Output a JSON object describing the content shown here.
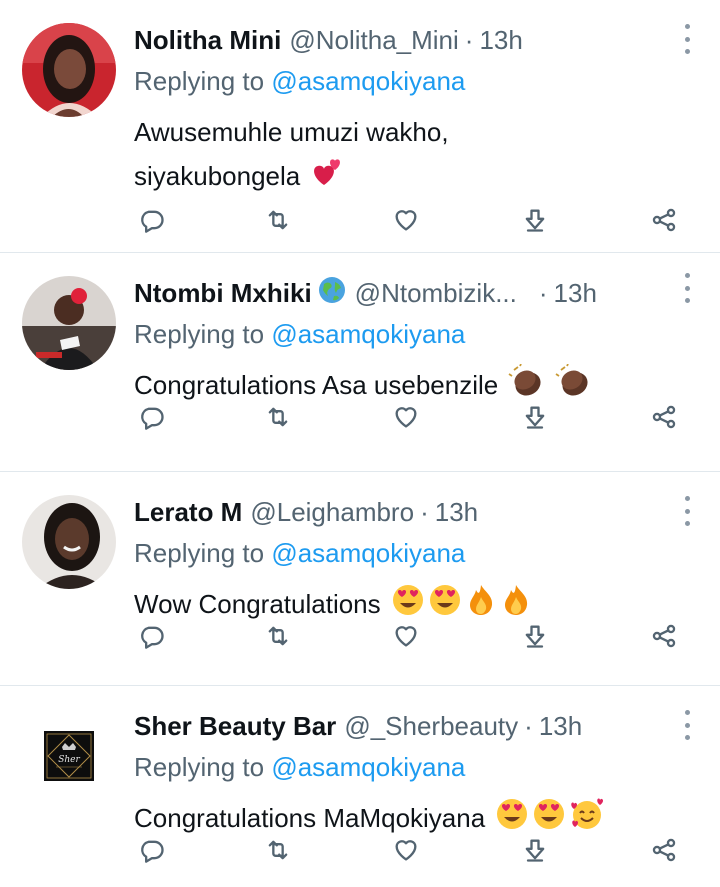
{
  "colors": {
    "name": "#0f1419",
    "secondary": "#536471",
    "link": "#1d9bf0",
    "divider": "#e1e8ed"
  },
  "replies": [
    {
      "name": "Nolitha Mini",
      "badge": "",
      "handle": "@Nolitha_Mini",
      "separator": "·",
      "time": "13h",
      "replying_prefix": "Replying to",
      "replying_handle": "@asamqokiyana",
      "text_lines": [
        "Awusemuhle umuzi wakho,",
        "siyakubongela"
      ],
      "emojis": [
        "two-hearts"
      ],
      "avatar": "woman-portrait-photo"
    },
    {
      "name": "Ntombi Mxhiki",
      "badge": "globe-emoji",
      "handle": "@Ntombizik...",
      "separator": "·",
      "time": "13h",
      "replying_prefix": "Replying to",
      "replying_handle": "@asamqokiyana",
      "text_lines": [
        "Congratulations Asa usebenzile"
      ],
      "emojis": [
        "clapping-hands",
        "clapping-hands"
      ],
      "avatar": "woman-photo-red-flower"
    },
    {
      "name": "Lerato M",
      "badge": "",
      "handle": "@Leighambro",
      "separator": "·",
      "time": "13h",
      "replying_prefix": "Replying to",
      "replying_handle": "@asamqokiyana",
      "text_lines": [
        "Wow Congratulations"
      ],
      "emojis": [
        "heart-eyes",
        "heart-eyes",
        "fire",
        "fire"
      ],
      "avatar": "woman-smiling-photo"
    },
    {
      "name": "Sher Beauty Bar",
      "badge": "",
      "handle": "@_Sherbeauty",
      "separator": "·",
      "time": "13h",
      "replying_prefix": "Replying to",
      "replying_handle": "@asamqokiyana",
      "text_lines": [
        "Congratulations MaMqokiyana"
      ],
      "emojis": [
        "heart-eyes",
        "heart-eyes",
        "smiling-face-with-hearts"
      ],
      "avatar": "sher-logo",
      "logo_text": "Sher"
    }
  ],
  "actions": [
    "reply-icon",
    "retweet-icon",
    "like-icon",
    "download-icon",
    "share-icon"
  ]
}
